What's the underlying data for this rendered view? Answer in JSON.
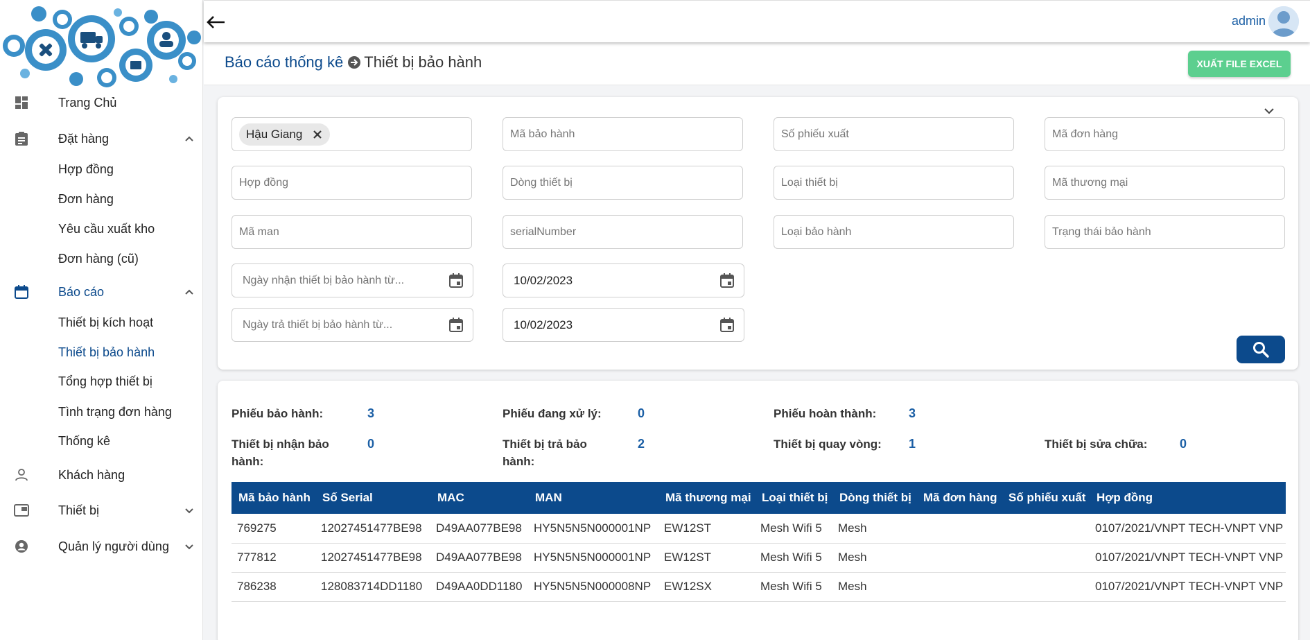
{
  "header": {
    "user_name": "admin"
  },
  "sidebar": {
    "items": [
      {
        "label": "Trang Chủ",
        "icon": "dashboard-icon"
      },
      {
        "label": "Đặt hàng",
        "icon": "clipboard-icon",
        "expanded": true,
        "children": [
          "Hợp đồng",
          "Đơn hàng",
          "Yêu cầu xuất kho",
          "Đơn hàng (cũ)"
        ]
      },
      {
        "label": "Báo cáo",
        "icon": "calendar-icon",
        "expanded": true,
        "active": true,
        "children": [
          "Thiết bị kích hoạt",
          "Thiết bị bảo hành",
          "Tổng hợp thiết bị",
          "Tình trạng đơn hàng",
          "Thống kê"
        ]
      },
      {
        "label": "Khách hàng",
        "icon": "person-icon"
      },
      {
        "label": "Thiết bị",
        "icon": "device-icon",
        "expanded": false
      },
      {
        "label": "Quản lý người dùng",
        "icon": "account-circle-icon",
        "expanded": false
      }
    ],
    "current_child": "Thiết bị bảo hành"
  },
  "page": {
    "breadcrumb_parent": "Báo cáo thống kê",
    "breadcrumb_current": "Thiết bị bảo hành",
    "export_button": "XUẤT FILE EXCEL"
  },
  "filters": {
    "province_chip": "Hậu Giang",
    "ma_bao_hanh": "Mã bảo hành",
    "so_phieu_xuat": "Số phiếu xuất",
    "ma_don_hang": "Mã đơn hàng",
    "hop_dong": "Hợp đồng",
    "dong_thiet_bi": "Dòng thiết bị",
    "loai_thiet_bi": "Loại thiết bị",
    "ma_thuong_mai": "Mã thương mại",
    "ma_man": "Mã man",
    "serial_number": "serialNumber",
    "loai_bao_hanh": "Loại bảo hành",
    "trang_thai_bao_hanh": "Trạng thái bảo hành",
    "ngay_nhan_tu": "Ngày nhận thiết bị bảo hành từ...",
    "ngay_nhan_den": "10/02/2023",
    "ngay_tra_tu": "Ngày trả thiết bị bảo hành từ...",
    "ngay_tra_den": "10/02/2023"
  },
  "stats": {
    "phieu_bao_hanh": {
      "label": "Phiếu bảo hành:",
      "value": "3"
    },
    "phieu_dang_xu_ly": {
      "label": "Phiếu đang xử lý:",
      "value": "0"
    },
    "phieu_hoan_thanh": {
      "label": "Phiếu hoàn thành:",
      "value": "3"
    },
    "thiet_bi_nhan_bao_hanh": {
      "label_line1": "Thiết bị nhận bảo",
      "label_line2": "hành:",
      "value": "0"
    },
    "thiet_bi_tra_bao_hanh": {
      "label_line1": "Thiết bị trả bảo",
      "label_line2": "hành:",
      "value": "2"
    },
    "thiet_bi_quay_vong": {
      "label": "Thiết bị quay vòng:",
      "value": "1"
    },
    "thiet_bi_sua_chua": {
      "label": "Thiết bị sửa chữa:",
      "value": "0"
    }
  },
  "table": {
    "columns": [
      "Mã bảo hành",
      "Số Serial",
      "MAC",
      "MAN",
      "Mã thương mại",
      "Loại thiết bị",
      "Dòng thiết bị",
      "Mã đơn hàng",
      "Số phiếu xuất",
      "Hợp đồng"
    ],
    "rows": [
      [
        "769275",
        "12027451477BE98",
        "D49AA077BE98",
        "HY5N5N5N000001NP",
        "EW12ST",
        "Mesh Wifi 5",
        "Mesh",
        "",
        "",
        "0107/2021/VNPT TECH-VNPT VNP"
      ],
      [
        "777812",
        "12027451477BE98",
        "D49AA077BE98",
        "HY5N5N5N000001NP",
        "EW12ST",
        "Mesh Wifi 5",
        "Mesh",
        "",
        "",
        "0107/2021/VNPT TECH-VNPT VNP"
      ],
      [
        "786238",
        "128083714DD1180",
        "D49AA0DD1180",
        "HY5N5N5N000008NP",
        "EW12SX",
        "Mesh Wifi 5",
        "Mesh",
        "",
        "",
        "0107/2021/VNPT TECH-VNPT VNP"
      ]
    ]
  },
  "colors": {
    "primary": "#0c4a8c",
    "link": "#1b5fa5",
    "export_green": "#5ccf8f"
  }
}
